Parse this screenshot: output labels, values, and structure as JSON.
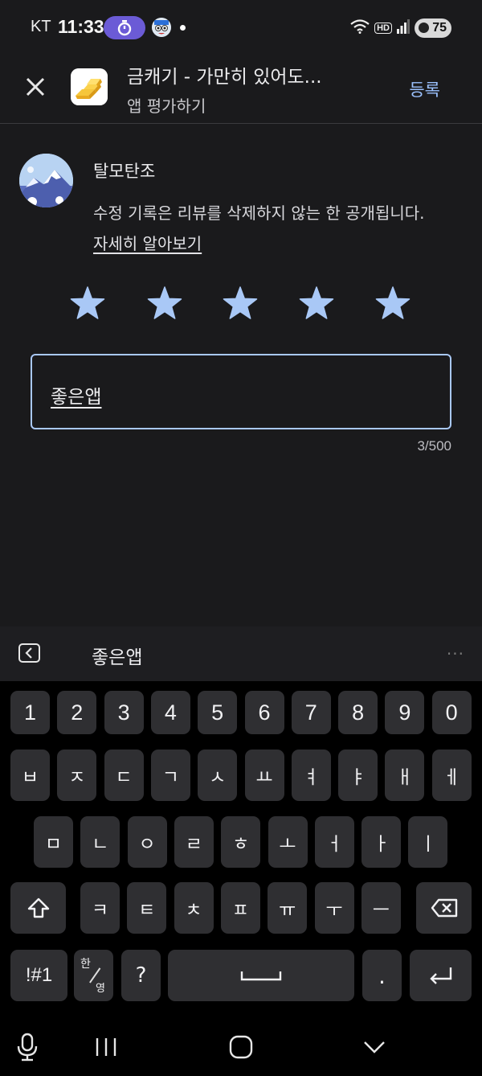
{
  "status_bar": {
    "carrier": "KT",
    "time": "11:33",
    "battery": "75",
    "hd_label": "HD",
    "icons": [
      "timer-icon",
      "mascot-icon",
      "wifi-icon",
      "signal-icon",
      "battery-icon"
    ]
  },
  "header": {
    "app_title": "금캐기 - 가만히 있어도...",
    "subtitle": "앱 평가하기",
    "register_label": "등록",
    "close_icon": "close-icon"
  },
  "user": {
    "name": "탈모탄조",
    "notice_text": "수정 기록은 리뷰를 삭제하지 않는 한 공개됩니다.",
    "learn_more": "자세히 알아보기"
  },
  "rating": {
    "value": 5,
    "max": 5,
    "star_color": "#a9c8f6"
  },
  "review": {
    "text": "좋은앱",
    "char_count": "3/500"
  },
  "suggestion_bar": {
    "word": "좋은앱",
    "more": "···"
  },
  "keyboard": {
    "number_row": [
      "1",
      "2",
      "3",
      "4",
      "5",
      "6",
      "7",
      "8",
      "9",
      "0"
    ],
    "row1": [
      "ㅂ",
      "ㅈ",
      "ㄷ",
      "ㄱ",
      "ㅅ",
      "ㅛ",
      "ㅕ",
      "ㅑ",
      "ㅐ",
      "ㅔ"
    ],
    "row2": [
      "ㅁ",
      "ㄴ",
      "ㅇ",
      "ㄹ",
      "ㅎ",
      "ㅗ",
      "ㅓ",
      "ㅏ",
      "ㅣ"
    ],
    "row3": [
      "ㅋ",
      "ㅌ",
      "ㅊ",
      "ㅍ",
      "ㅠ",
      "ㅜ",
      "ㅡ"
    ],
    "symbols_key": "!#1",
    "lang_key_top": "한",
    "lang_key_bottom": "영",
    "question_key": "?",
    "period_key": "."
  },
  "colors": {
    "background": "#1a1a1c",
    "accent": "#9cc2ff",
    "field_border": "#a9c8f6"
  }
}
